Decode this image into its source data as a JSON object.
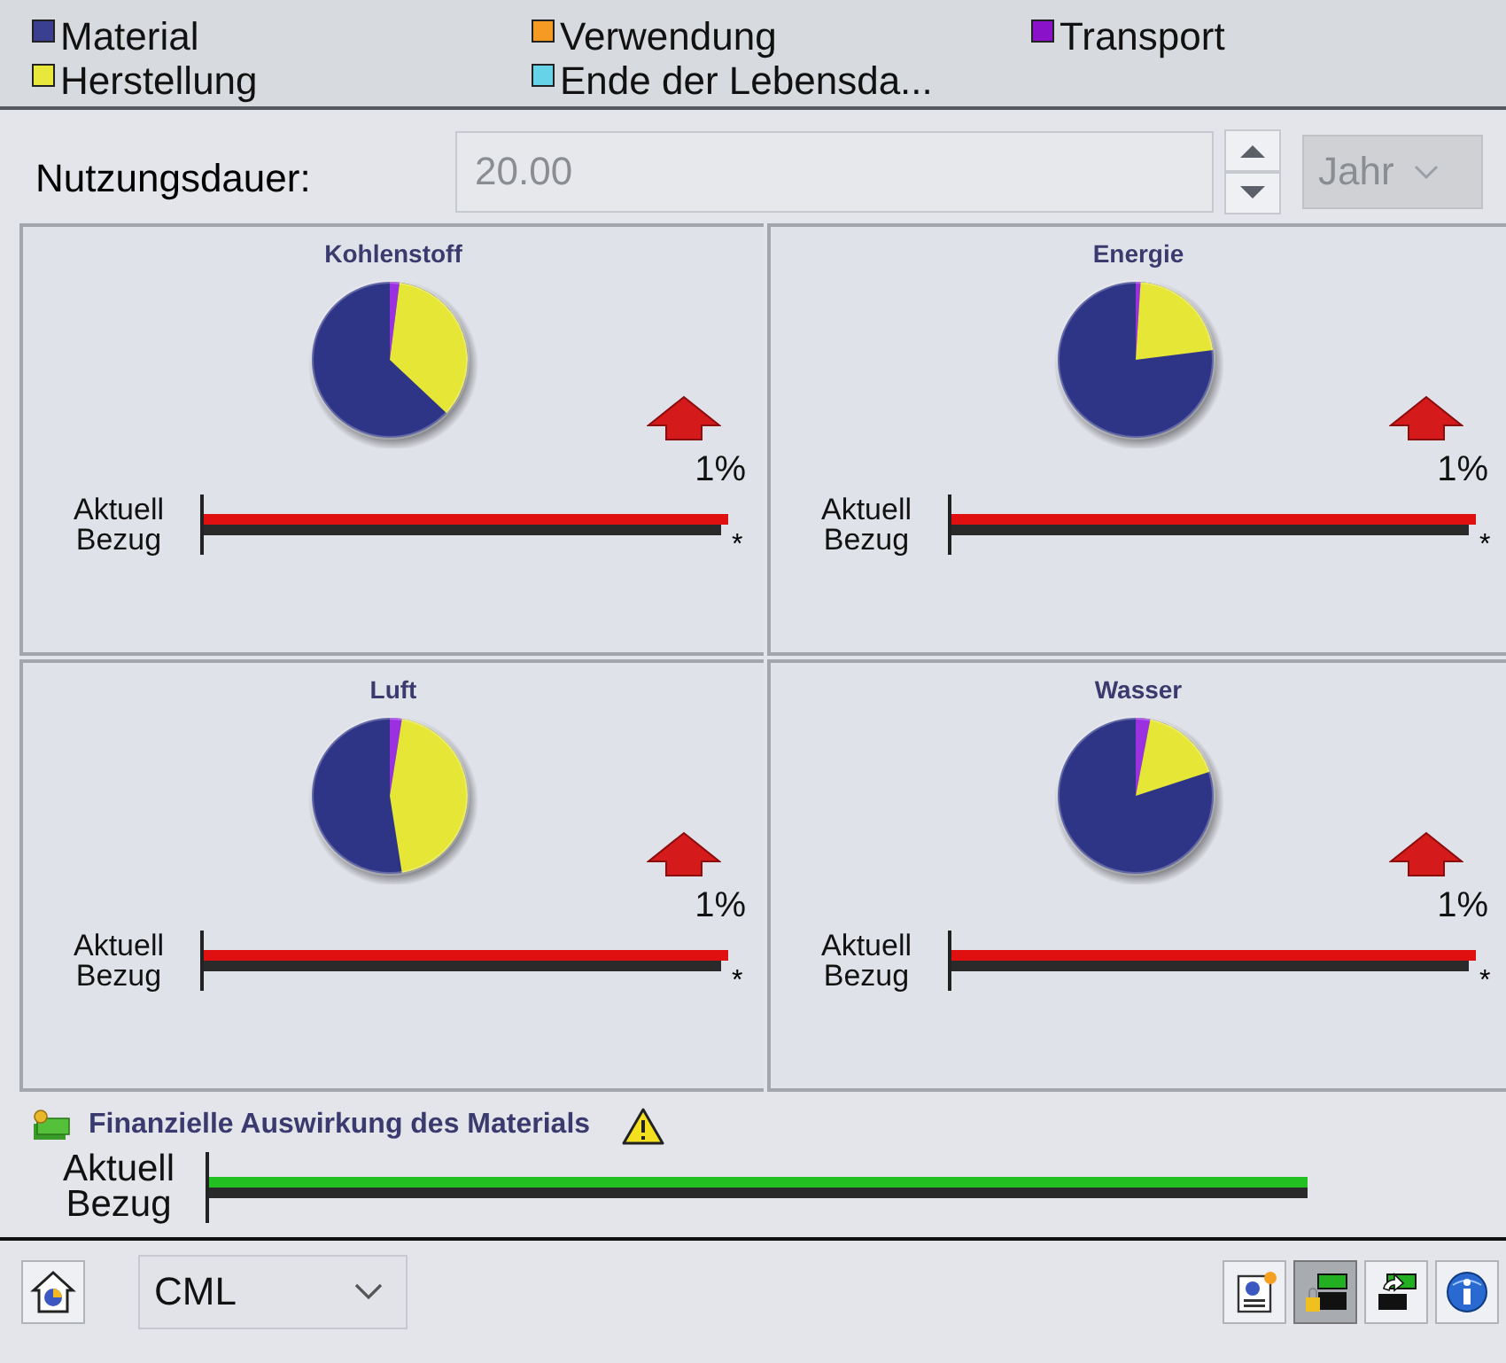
{
  "legend": [
    {
      "label": "Material",
      "color": "#3b3f8f"
    },
    {
      "label": "Verwendung",
      "color": "#f59a23"
    },
    {
      "label": "Transport",
      "color": "#8a12c9"
    },
    {
      "label": "Herstellung",
      "color": "#e8e83a"
    },
    {
      "label": "Ende der Lebensda...",
      "color": "#66d3e8"
    }
  ],
  "lifetime": {
    "label": "Nutzungsdauer:",
    "value": "20.00",
    "unit": "Jahr",
    "disabled": true
  },
  "panels": [
    {
      "title": "Kohlenstoff",
      "change": "1%",
      "bars": [
        {
          "kind": "current",
          "label": "Aktuell",
          "level": 1.0
        },
        {
          "kind": "reference",
          "label": "Bezug",
          "level": 0.985
        }
      ],
      "note": "*"
    },
    {
      "title": "Energie",
      "change": "1%",
      "bars": [
        {
          "kind": "current",
          "label": "Aktuell",
          "level": 1.0
        },
        {
          "kind": "reference",
          "label": "Bezug",
          "level": 0.985
        }
      ],
      "note": "*"
    },
    {
      "title": "Luft",
      "change": "1%",
      "bars": [
        {
          "kind": "current",
          "label": "Aktuell",
          "level": 1.0
        },
        {
          "kind": "reference",
          "label": "Bezug",
          "level": 0.985
        }
      ],
      "note": "*"
    },
    {
      "title": "Wasser",
      "change": "1%",
      "bars": [
        {
          "kind": "current",
          "label": "Aktuell",
          "level": 1.0
        },
        {
          "kind": "reference",
          "label": "Bezug",
          "level": 0.985
        }
      ],
      "note": "*"
    }
  ],
  "financial": {
    "title": "Finanzielle Auswirkung des Materials",
    "bars": [
      {
        "kind": "current",
        "label": "Aktuell",
        "level": 0.99
      },
      {
        "kind": "reference",
        "label": "Bezug",
        "level": 0.99
      }
    ]
  },
  "toolbar": {
    "method": "CML",
    "tools": [
      {
        "selected": false
      },
      {
        "selected": true
      },
      {
        "selected": false
      },
      {
        "selected": false
      }
    ]
  }
}
